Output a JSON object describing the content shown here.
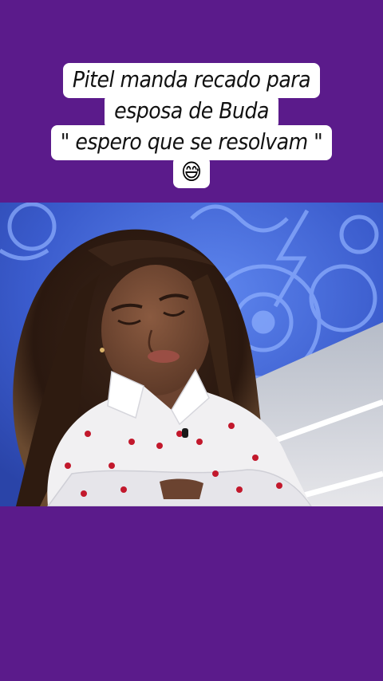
{
  "caption": {
    "lines": [
      "Pitel manda recado para",
      "esposa de Buda",
      "\" espero que se resolvam \""
    ],
    "emoji": "😅"
  },
  "colors": {
    "background": "#5b1b8b",
    "caption_bg": "#ffffff",
    "caption_text": "#111111",
    "set_blue": "#3d5fd0"
  },
  "video": {
    "subject": "woman-with-curly-hair",
    "shirt": "white-shirt-red-hearts"
  }
}
